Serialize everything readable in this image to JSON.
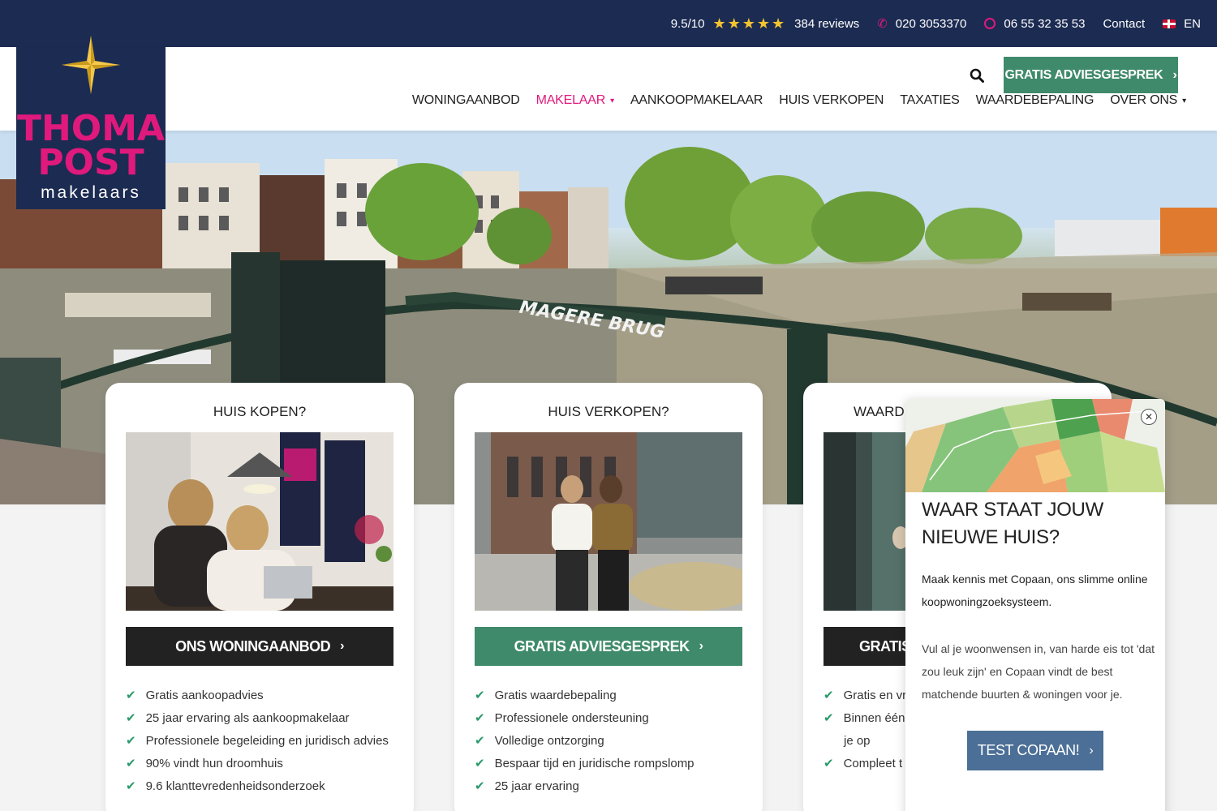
{
  "topbar": {
    "rating": "9.5/10",
    "star_count": 5,
    "reviews": "384 reviews",
    "phone": "020 3053370",
    "whatsapp": "06 55 32 35 53",
    "contact": "Contact",
    "language": "EN"
  },
  "logo": {
    "line1": "THOMA",
    "line2": "POST",
    "line3": "makelaars"
  },
  "header": {
    "cta": "GRATIS ADVIESGESPREK",
    "nav": [
      {
        "label": "WONINGAANBOD"
      },
      {
        "label": "MAKELAAR"
      },
      {
        "label": "AANKOOPMAKELAAR"
      },
      {
        "label": "HUIS VERKOPEN"
      },
      {
        "label": "TAXATIES"
      },
      {
        "label": "WAARDEBEPALING"
      },
      {
        "label": "OVER ONS"
      }
    ]
  },
  "hero": {
    "sign": "MAGERE BRUG"
  },
  "cards": [
    {
      "title": "HUIS KOPEN?",
      "button": "ONS WONINGAANBOD",
      "items": [
        "Gratis aankoopadvies",
        "25 jaar ervaring als aankoopmakelaar",
        "Professionele begeleiding en juridisch advies",
        "90% vindt hun droomhuis",
        "9.6 klanttevredenheidsonderzoek"
      ]
    },
    {
      "title": "HUIS VERKOPEN?",
      "button": "GRATIS ADVIESGESPREK",
      "items": [
        "Gratis waardebepaling",
        "Professionele ondersteuning",
        "Volledige ontzorging",
        "Bespaar tijd en juridische rompslomp",
        "25 jaar ervaring"
      ]
    },
    {
      "title": "WAARD",
      "button": "GRATIS",
      "items": [
        "Gratis en vri",
        "Binnen één",
        "je op",
        "Compleet t"
      ]
    }
  ],
  "popup": {
    "title": "WAAR STAAT JOUW NIEUWE HUIS?",
    "lead": "Maak kennis met Copaan, ons slimme online koopwoningzoeksysteem.",
    "text": "Vul al je woonwensen in, van harde eis tot 'dat zou leuk zijn' en Copaan vindt de best matchende buurten & woningen voor je.",
    "button": "TEST COPAAN!"
  },
  "colors": {
    "navy": "#1c2b52",
    "pink": "#e0197d",
    "green": "#3f8a6b",
    "popup_button": "#4b6f96"
  }
}
